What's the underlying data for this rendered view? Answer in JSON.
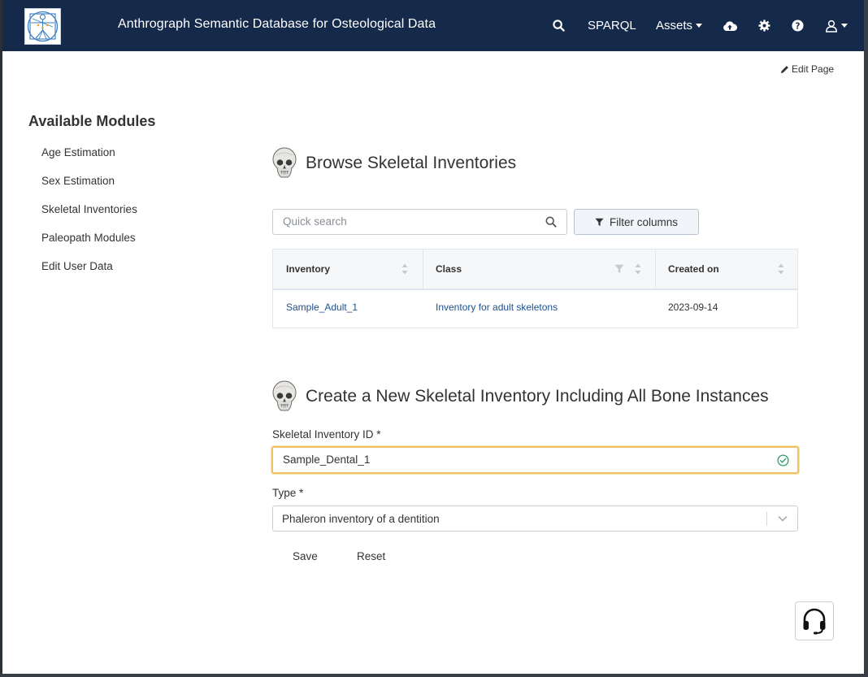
{
  "navbar": {
    "title": "Anthrograph Semantic Database for Osteological Data",
    "sparql_label": "SPARQL",
    "assets_label": "Assets",
    "icons": [
      "search-icon",
      "cloud-upload-icon",
      "gear-icon",
      "question-icon",
      "user-icon"
    ]
  },
  "edit_page_label": "Edit Page",
  "sidebar": {
    "title": "Available Modules",
    "items": [
      {
        "label": "Age Estimation"
      },
      {
        "label": "Sex Estimation"
      },
      {
        "label": "Skeletal Inventories"
      },
      {
        "label": "Paleopath Modules"
      },
      {
        "label": "Edit User Data"
      }
    ]
  },
  "browse": {
    "heading": "Browse Skeletal Inventories",
    "search_placeholder": "Quick search",
    "filter_label": "Filter columns",
    "columns": [
      "Inventory",
      "Class",
      "Created on"
    ],
    "rows": [
      {
        "inventory": "Sample_Adult_1",
        "class": "Inventory for adult skeletons",
        "created": "2023-09-14"
      }
    ]
  },
  "create": {
    "heading": "Create a New Skeletal Inventory Including All Bone Instances",
    "id_label": "Skeletal Inventory ID *",
    "id_value": "Sample_Dental_1",
    "type_label": "Type *",
    "type_value": "Phaleron inventory of a dentition",
    "save_label": "Save",
    "reset_label": "Reset"
  },
  "colors": {
    "navbar_bg": "#15294b",
    "link": "#1e4f8c",
    "input_focus": "#f0c266",
    "valid": "#2e9e6b"
  }
}
